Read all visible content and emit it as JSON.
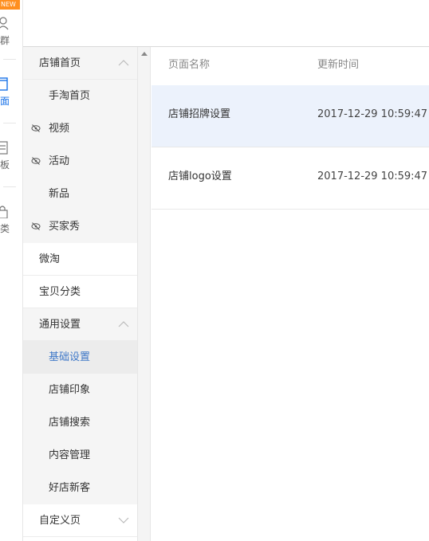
{
  "rail": {
    "badge": "NEW",
    "items": [
      {
        "label": "群",
        "icon": "user-icon"
      },
      {
        "label": "面",
        "icon": "page-icon",
        "active": true
      },
      {
        "label": "板",
        "icon": "template-icon"
      },
      {
        "label": "类",
        "icon": "bag-icon"
      }
    ]
  },
  "nav": {
    "items": [
      {
        "label": "店铺首页",
        "type": "top",
        "chevron": "up"
      },
      {
        "label": "手淘首页",
        "type": "sub"
      },
      {
        "label": "视频",
        "type": "sub",
        "hidden_icon": true
      },
      {
        "label": "活动",
        "type": "sub",
        "hidden_icon": true
      },
      {
        "label": "新品",
        "type": "sub"
      },
      {
        "label": "买家秀",
        "type": "sub",
        "hidden_icon": true
      },
      {
        "label": "微淘",
        "type": "section"
      },
      {
        "label": "宝贝分类",
        "type": "section"
      },
      {
        "label": "通用设置",
        "type": "top",
        "chevron": "up"
      },
      {
        "label": "基础设置",
        "type": "sub",
        "selected": true
      },
      {
        "label": "店铺印象",
        "type": "sub"
      },
      {
        "label": "店铺搜索",
        "type": "sub"
      },
      {
        "label": "内容管理",
        "type": "sub"
      },
      {
        "label": "好店新客",
        "type": "sub"
      },
      {
        "label": "自定义页",
        "type": "section",
        "chevron": "down"
      }
    ]
  },
  "table": {
    "headers": {
      "name": "页面名称",
      "time": "更新时间"
    },
    "rows": [
      {
        "name": "店铺招牌设置",
        "time": "2017-12-29 10:59:47",
        "highlight": true
      },
      {
        "name": "店铺logo设置",
        "time": "2017-12-29 10:59:47"
      }
    ]
  },
  "colors": {
    "accent": "#3f78c8",
    "badge": "#ff8f1f",
    "row_highlight": "#ecf2fc"
  }
}
